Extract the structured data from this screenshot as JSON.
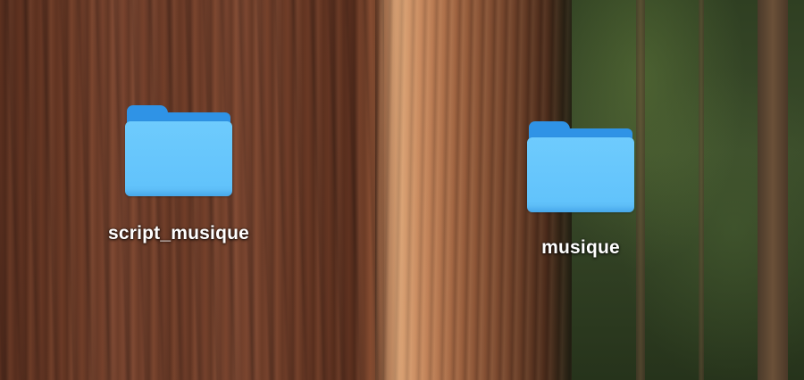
{
  "desktop": {
    "wallpaper": "redwood-forest",
    "icons": [
      {
        "type": "folder",
        "label": "script_musique",
        "color": "#62c3fb"
      },
      {
        "type": "folder",
        "label": "musique",
        "color": "#62c3fb"
      }
    ]
  }
}
